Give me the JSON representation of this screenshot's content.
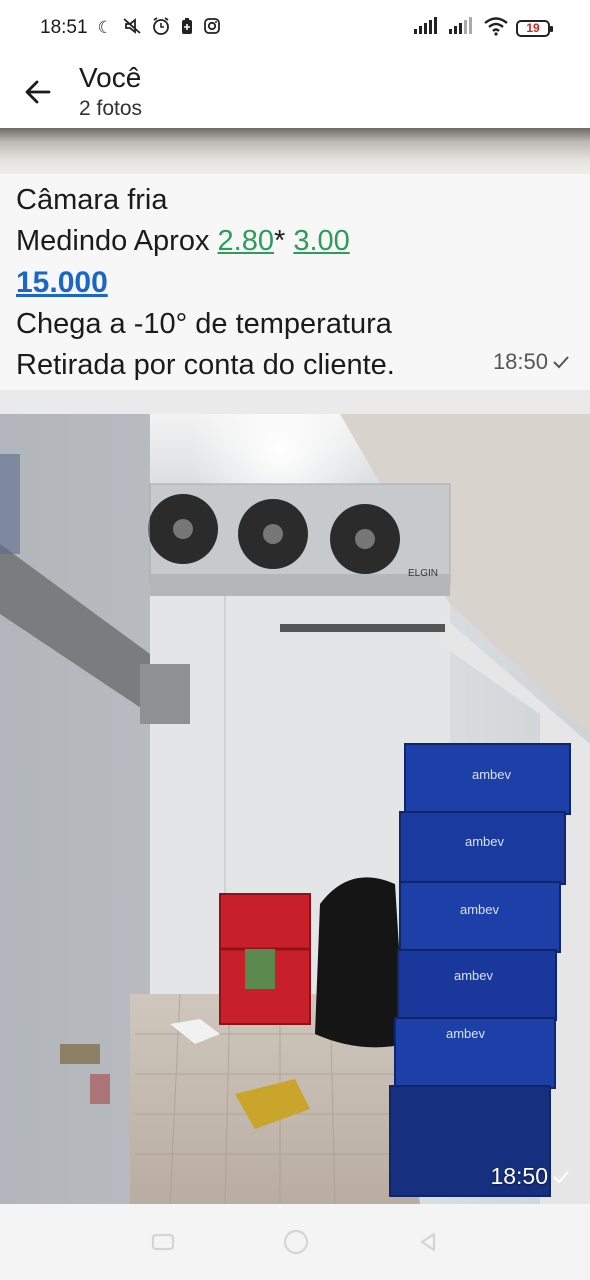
{
  "status_bar": {
    "time": "18:51",
    "battery": "19",
    "icons": [
      "moon-icon",
      "mute-icon",
      "alarm-icon",
      "battery-saver-icon",
      "instagram-icon",
      "signal-icon",
      "signal-icon",
      "wifi-icon",
      "battery-icon"
    ]
  },
  "header": {
    "title": "Você",
    "subtitle": "2 fotos",
    "back_icon": "arrow-left-icon"
  },
  "caption": {
    "line1": "Câmara fria",
    "line2_prefix": "Medindo Aprox ",
    "line2_num1": "2.80",
    "line2_sep": "* ",
    "line2_num2": "3.00",
    "line3": "15.000",
    "line4": "Chega a -10° de temperatura",
    "line5": "Retirada por conta do cliente.",
    "time": "18:50",
    "status_icon": "check-icon"
  },
  "photo": {
    "time": "18:50",
    "status_icon": "check-icon",
    "crate_brand": "ambev",
    "unit_brand": "ELGIN"
  },
  "nav": {
    "icons": [
      "recent-apps-icon",
      "home-icon",
      "back-icon"
    ]
  },
  "colors": {
    "link_green": "#2e9c5a",
    "link_blue": "#1a66c9",
    "crate_blue": "#1d3fa8",
    "crate_red": "#c8202a"
  }
}
